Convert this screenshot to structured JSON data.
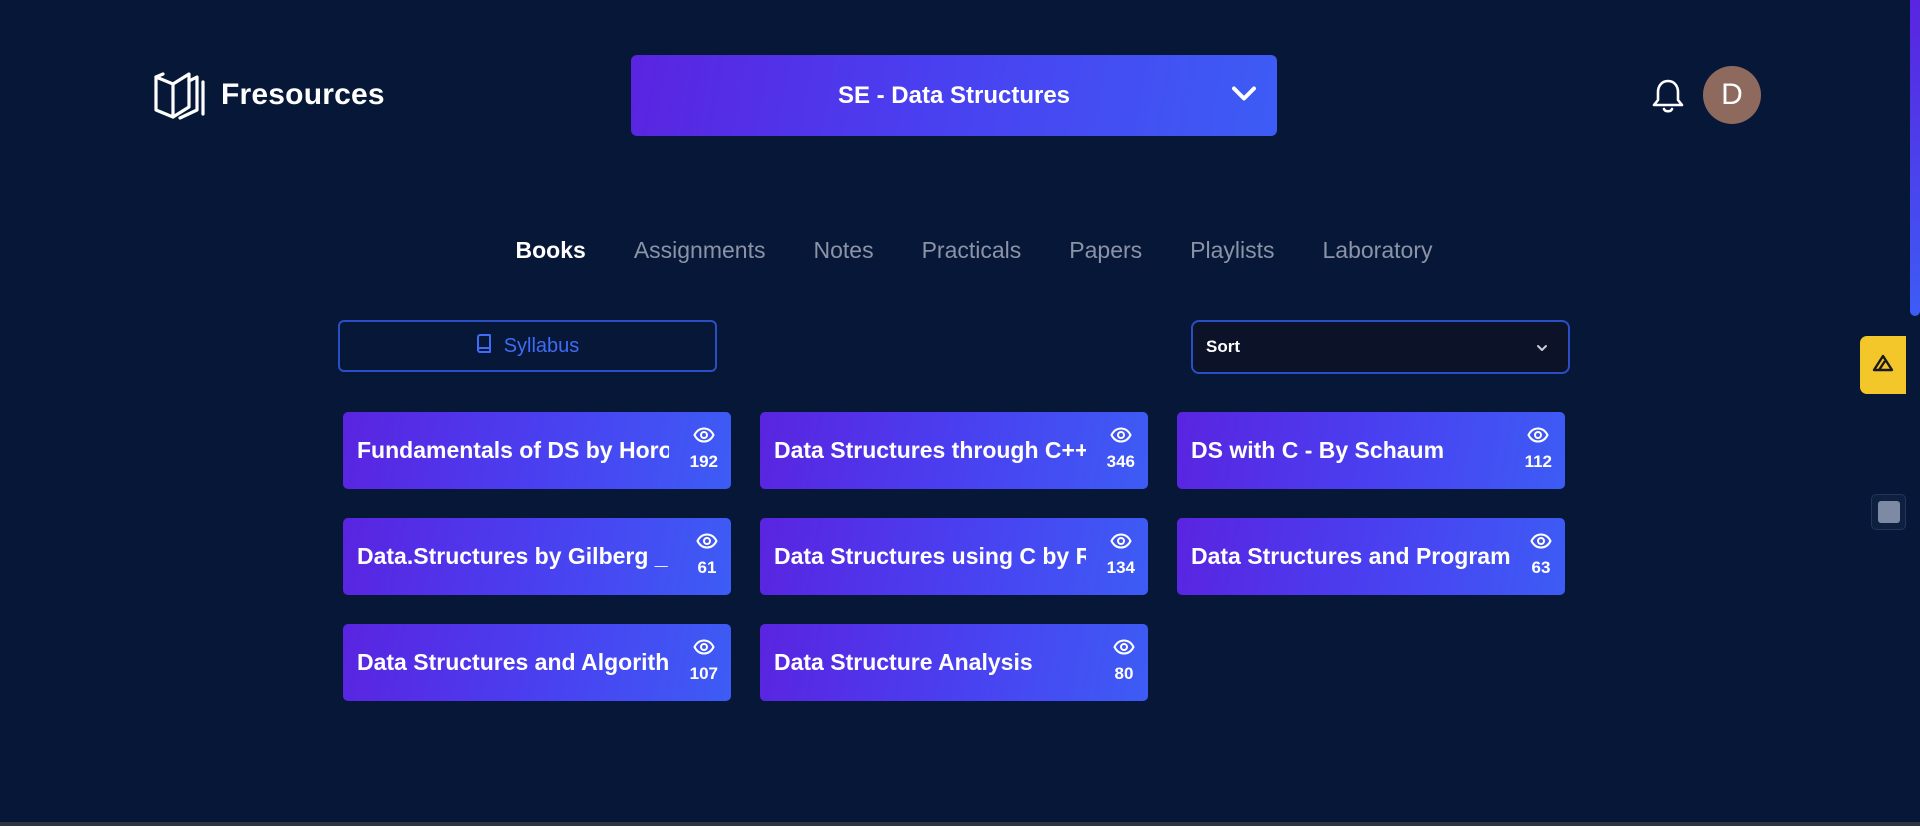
{
  "app": {
    "name": "Fresources"
  },
  "header": {
    "subject": "SE - Data Structures",
    "avatar_initial": "D"
  },
  "tabs": [
    {
      "label": "Books",
      "active": true
    },
    {
      "label": "Assignments",
      "active": false
    },
    {
      "label": "Notes",
      "active": false
    },
    {
      "label": "Practicals",
      "active": false
    },
    {
      "label": "Papers",
      "active": false
    },
    {
      "label": "Playlists",
      "active": false
    },
    {
      "label": "Laboratory",
      "active": false
    }
  ],
  "controls": {
    "syllabus_label": "Syllabus",
    "sort_label": "Sort"
  },
  "books": [
    {
      "title": "Fundamentals of DS by Horow",
      "views": "192"
    },
    {
      "title": "Data Structures through C++",
      "views": "346"
    },
    {
      "title": "DS with C - By Schaum",
      "views": "112"
    },
    {
      "title": "Data.Structures by Gilberg _ F",
      "views": "61"
    },
    {
      "title": "Data Structures using C by Re",
      "views": "134"
    },
    {
      "title": "Data Structures and Program",
      "views": "63"
    },
    {
      "title": "Data Structures and Algorithi",
      "views": "107"
    },
    {
      "title": "Data Structure Analysis",
      "views": "80"
    }
  ],
  "colors": {
    "background": "#071737",
    "accent_gradient_start": "#5a24e0",
    "accent_gradient_end": "#3d5cf5",
    "tab_inactive": "#8b93a7",
    "syllabus_text": "#3f6bf5",
    "widget_yellow": "#f3c629",
    "avatar_bg": "#8d6a5d"
  },
  "icons": {
    "logo": "book-logo-icon",
    "subject_dropdown": "chevron-down-icon",
    "notifications": "bell-icon",
    "syllabus": "book-icon",
    "sort_dropdown": "chevron-down-icon",
    "views": "eye-icon"
  }
}
